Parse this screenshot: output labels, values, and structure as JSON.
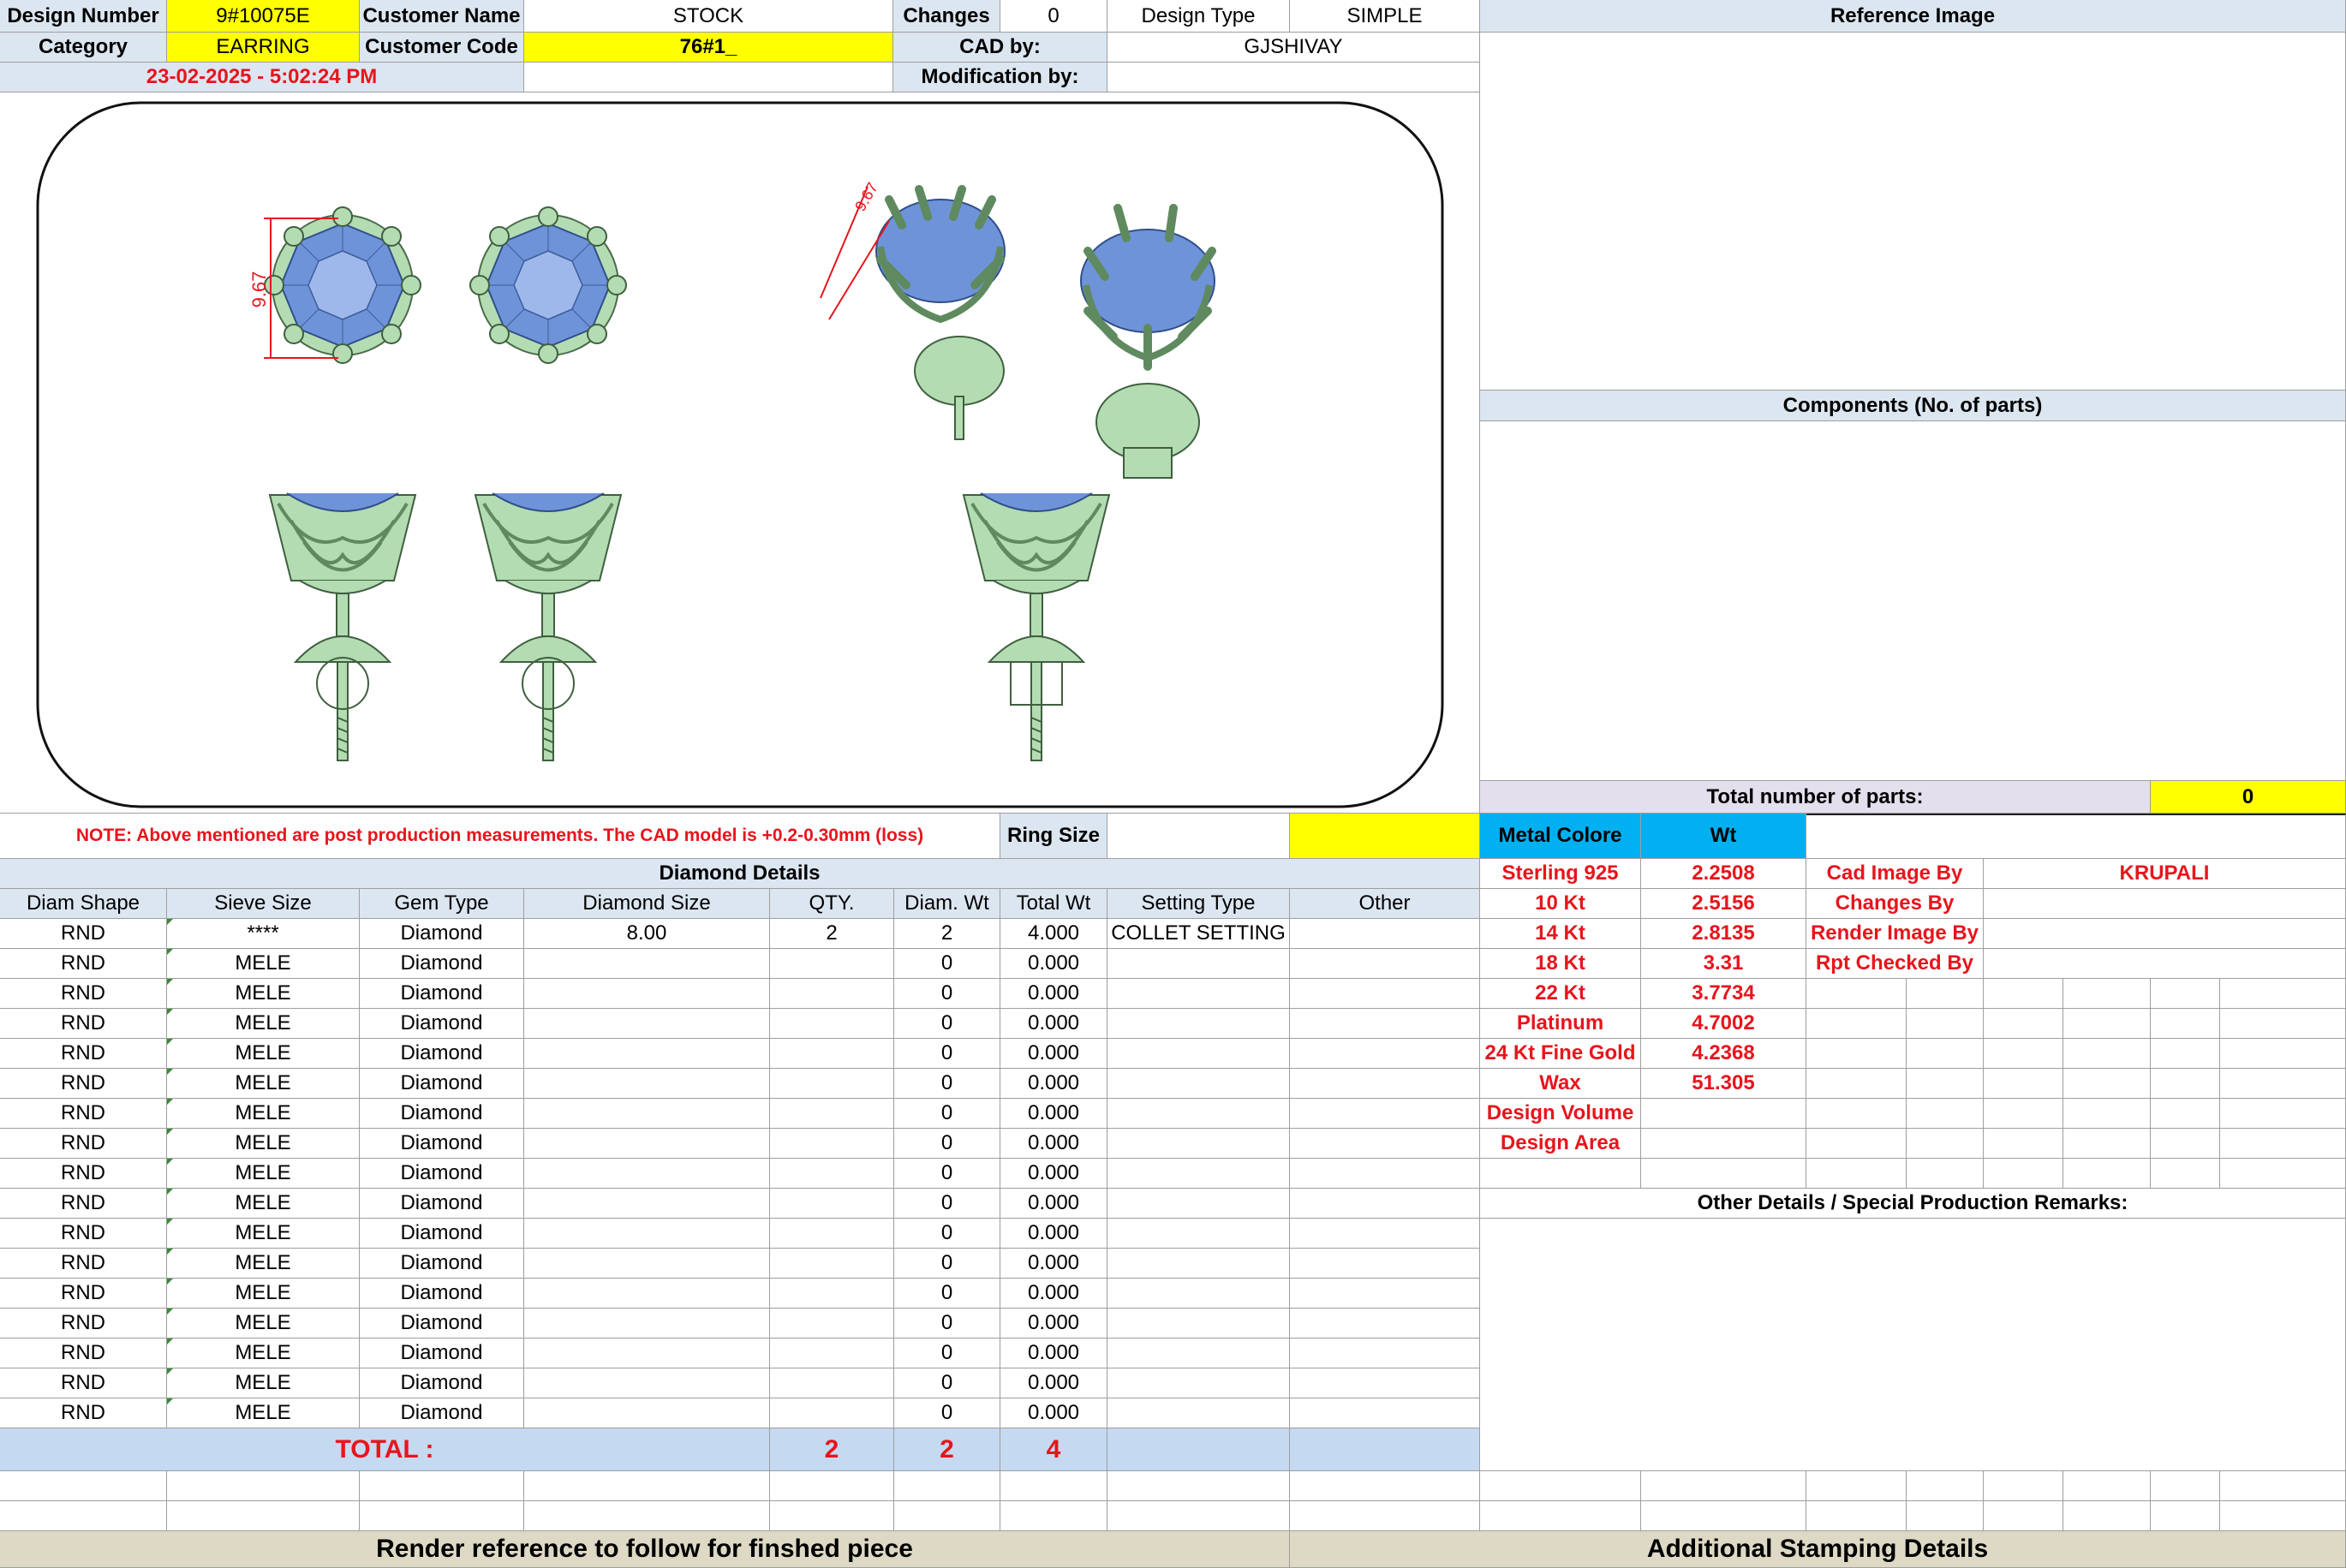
{
  "header": {
    "design_number_label": "Design Number",
    "design_number": "9#10075E",
    "customer_name_label": "Customer Name",
    "customer_name": "STOCK",
    "changes_label": "Changes",
    "changes": "0",
    "design_type_label": "Design Type",
    "design_type": "SIMPLE",
    "category_label": "Category",
    "category": "EARRING",
    "customer_code_label": "Customer Code",
    "customer_code": "76#1_",
    "cad_by_label": "CAD by:",
    "cad_by": "GJSHIVAY",
    "date": "23-02-2025 - 5:02:24 PM",
    "modification_label": "Modification by:",
    "modification": ""
  },
  "render": {
    "dimension_1": "9.67",
    "dimension_2": "9.67"
  },
  "note": "NOTE: Above mentioned are post production measurements. The CAD model is +0.2-0.30mm (loss)",
  "ring_size_label": "Ring Size",
  "ring_size": "",
  "reference_image_label": "Reference Image",
  "components_label": "Components (No. of parts)",
  "total_parts_label": "Total number of parts:",
  "total_parts": "0",
  "metal": {
    "colore_label": "Metal Colore",
    "wt_label": "Wt",
    "rows": [
      {
        "name": "Sterling 925",
        "wt": "2.2508"
      },
      {
        "name": "10 Kt",
        "wt": "2.5156"
      },
      {
        "name": "14 Kt",
        "wt": "2.8135"
      },
      {
        "name": "18 Kt",
        "wt": "3.31"
      },
      {
        "name": "22 Kt",
        "wt": "3.7734"
      },
      {
        "name": "Platinum",
        "wt": "4.7002"
      },
      {
        "name": "24 Kt Fine Gold",
        "wt": "4.2368"
      },
      {
        "name": "Wax",
        "wt": "51.305"
      },
      {
        "name": "Design Volume",
        "wt": ""
      },
      {
        "name": "Design Area",
        "wt": ""
      }
    ]
  },
  "credits": [
    {
      "label": "Cad Image By",
      "value": "KRUPALI"
    },
    {
      "label": "Changes By",
      "value": ""
    },
    {
      "label": "Render Image By",
      "value": ""
    },
    {
      "label": "Rpt Checked By",
      "value": ""
    }
  ],
  "other_details_label": "Other Details / Special Production Remarks:",
  "diamond": {
    "title": "Diamond Details",
    "columns": [
      "Diam Shape",
      "Sieve Size",
      "Gem Type",
      "Diamond Size",
      "QTY.",
      "Diam. Wt",
      "Total Wt",
      "Setting Type",
      "Other"
    ],
    "rows": [
      [
        "RND",
        "****",
        "Diamond",
        "8.00",
        "2",
        "2",
        "4.000",
        "COLLET SETTING",
        ""
      ],
      [
        "RND",
        "MELE",
        "Diamond",
        "",
        "",
        "0",
        "0.000",
        "",
        ""
      ],
      [
        "RND",
        "MELE",
        "Diamond",
        "",
        "",
        "0",
        "0.000",
        "",
        ""
      ],
      [
        "RND",
        "MELE",
        "Diamond",
        "",
        "",
        "0",
        "0.000",
        "",
        ""
      ],
      [
        "RND",
        "MELE",
        "Diamond",
        "",
        "",
        "0",
        "0.000",
        "",
        ""
      ],
      [
        "RND",
        "MELE",
        "Diamond",
        "",
        "",
        "0",
        "0.000",
        "",
        ""
      ],
      [
        "RND",
        "MELE",
        "Diamond",
        "",
        "",
        "0",
        "0.000",
        "",
        ""
      ],
      [
        "RND",
        "MELE",
        "Diamond",
        "",
        "",
        "0",
        "0.000",
        "",
        ""
      ],
      [
        "RND",
        "MELE",
        "Diamond",
        "",
        "",
        "0",
        "0.000",
        "",
        ""
      ],
      [
        "RND",
        "MELE",
        "Diamond",
        "",
        "",
        "0",
        "0.000",
        "",
        ""
      ],
      [
        "RND",
        "MELE",
        "Diamond",
        "",
        "",
        "0",
        "0.000",
        "",
        ""
      ],
      [
        "RND",
        "MELE",
        "Diamond",
        "",
        "",
        "0",
        "0.000",
        "",
        ""
      ],
      [
        "RND",
        "MELE",
        "Diamond",
        "",
        "",
        "0",
        "0.000",
        "",
        ""
      ],
      [
        "RND",
        "MELE",
        "Diamond",
        "",
        "",
        "0",
        "0.000",
        "",
        ""
      ],
      [
        "RND",
        "MELE",
        "Diamond",
        "",
        "",
        "0",
        "0.000",
        "",
        ""
      ],
      [
        "RND",
        "MELE",
        "Diamond",
        "",
        "",
        "0",
        "0.000",
        "",
        ""
      ],
      [
        "RND",
        "MELE",
        "Diamond",
        "",
        "",
        "0",
        "0.000",
        "",
        ""
      ]
    ],
    "total_label": "TOTAL :",
    "total_qty": "2",
    "total_diam_wt": "2",
    "total_wt": "4"
  },
  "footer": {
    "render_reference": "Render reference to follow for finshed piece",
    "stamping": "Additional Stamping Details"
  },
  "colors": {
    "header_blue": "#dce6f1",
    "highlight_yellow": "#ffff00",
    "metal_blue": "#00b0f0",
    "label_red": "#e8141c",
    "footer_tan": "#ddd9c4",
    "gem_blue": "#6f93d8",
    "metal_green": "#b3dcb2"
  }
}
